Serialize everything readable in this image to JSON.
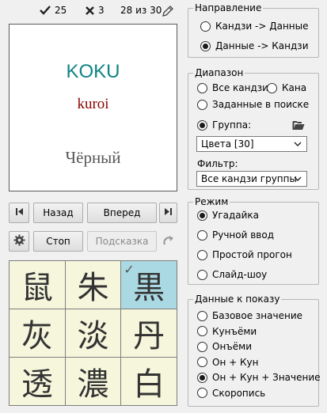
{
  "stats": {
    "correct_count": "25",
    "wrong_count": "3",
    "progress_text": "28 из 30"
  },
  "card": {
    "romaji": "KOKU",
    "reading": "kuroi",
    "meaning": "Чёрный"
  },
  "nav": {
    "back_label": "Назад",
    "forward_label": "Вперед",
    "stop_label": "Стоп",
    "hint_label": "Подсказка"
  },
  "kanji_grid": [
    {
      "char": "鼠",
      "selected": false
    },
    {
      "char": "朱",
      "selected": false
    },
    {
      "char": "黒",
      "selected": true
    },
    {
      "char": "灰",
      "selected": false
    },
    {
      "char": "淡",
      "selected": false
    },
    {
      "char": "丹",
      "selected": false
    },
    {
      "char": "透",
      "selected": false
    },
    {
      "char": "濃",
      "selected": false
    },
    {
      "char": "白",
      "selected": false
    }
  ],
  "direction": {
    "title": "Направление",
    "options": [
      "Кандзи -> Данные",
      "Данные -> Кандзи"
    ],
    "selected": 1
  },
  "range": {
    "title": "Диапазон",
    "all_kanji": "Все кандзи",
    "kana": "Кана",
    "search": "Заданные в поиске",
    "group": "Группа:",
    "group_value": "Цвета [30]",
    "filter_label": "Фильтр:",
    "filter_value": "Все кандзи группы",
    "selected": "group"
  },
  "mode": {
    "title": "Режим",
    "options": [
      "Угадайка",
      "Ручной ввод",
      "Простой прогон",
      "Слайд-шоу"
    ],
    "selected": 0
  },
  "display": {
    "title": "Данные к показу",
    "options": [
      "Базовое значение",
      "Кунъёми",
      "Онъёми",
      "Он + Кун",
      "Он + Кун + Значение",
      "Скоропись"
    ],
    "selected": 4
  },
  "colors": {
    "romaji": "#0f8384",
    "reading": "#8b0000",
    "cell_bg": "#f6f6dd",
    "cell_selected_bg": "#abd9e3"
  }
}
